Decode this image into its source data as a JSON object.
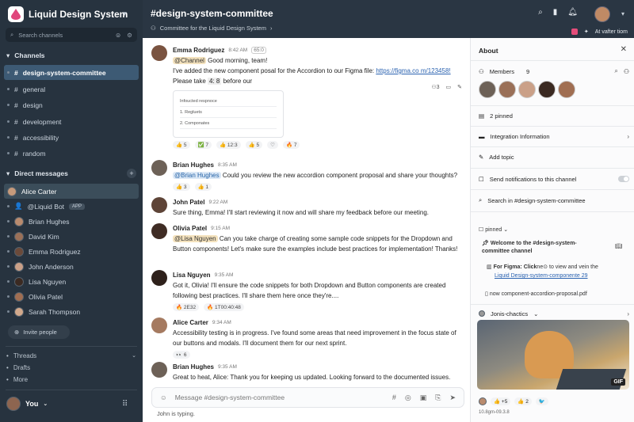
{
  "workspace": {
    "name": "Liquid Design System"
  },
  "sidebar": {
    "search_placeholder": "Search channels",
    "channels_label": "Channels",
    "channels": [
      {
        "name": "design-system-committee",
        "active": true
      },
      {
        "name": "general"
      },
      {
        "name": "design"
      },
      {
        "name": "development"
      },
      {
        "name": "accessibility"
      },
      {
        "name": "random"
      }
    ],
    "dm_label": "Direct messages",
    "dms": [
      {
        "name": "Alice Carter",
        "active": true
      },
      {
        "name": "@Liquid Bot",
        "badge": "APP"
      },
      {
        "name": "Brian Hughes"
      },
      {
        "name": "David Kim"
      },
      {
        "name": "Emma Rodriguez"
      },
      {
        "name": "John Anderson"
      },
      {
        "name": "Lisa Nguyen"
      },
      {
        "name": "Olivia Patel"
      },
      {
        "name": "Sarah Thompson"
      }
    ],
    "invite": "Invite people",
    "threads": "Threads",
    "drafts": "Drafts",
    "more": "More",
    "user": "You"
  },
  "header": {
    "title": "#design-system-committee",
    "subtitle": "Committee for the Liquid Design System",
    "right_text": "At vafter tiom"
  },
  "messages": [
    {
      "author": "Emma Rodriguez",
      "time": "8:42 AM",
      "tag": "65:0",
      "mention": "@Channel",
      "line1": " Good morning, team!",
      "line2a": "I've added the new component posal for the Accordion to our Figma file: ",
      "link": "https://figma.co m/123458!",
      "line2b": " Please take ",
      "hl": "4: 8",
      "line2c": " before our",
      "mini": [
        "Infoucted respnoce",
        "1. Regluets",
        "2. Componates"
      ],
      "reactions": [
        "👍 5",
        "✅ 7",
        "👍 12:3",
        "👍 5",
        "♡",
        "🔥 7",
        "😄 7"
      ]
    },
    {
      "author": "Brian Hughes",
      "time": "8:35 AM",
      "mention": "@Brian Hughes",
      "text": "Could you review the new accordion component proposal and share your thoughts?",
      "reactions": [
        "👍 3",
        "👍 1"
      ]
    },
    {
      "author": "John Patel",
      "time": "9:22 AM",
      "text": "Sure thing, Emma! I'll start reviewing it now and will share my feedback before our meeting."
    },
    {
      "author": "Olivia Patel",
      "time": "9:15 AM",
      "mention": "@Lisa Nguyen",
      "text": "Can you take charge of creating some sample code snippets for the Dropdown and Button components! Let's make sure the examples include best practices for implementation! Thanks!"
    },
    {
      "author": "Lisa Nguyen",
      "time": "9:35 AM",
      "text": "Got it, Olivia! I'll ensure the code snippets for both Dropdown and Button components are created following best practices. I'll share them here once they're....",
      "reactions": [
        "🔥 2E32",
        "🔥 1T00:40:48"
      ]
    },
    {
      "author": "Alice Carter",
      "time": "9:34 AM",
      "text": "Accessibility testing is in progress. I've found some areas that need improvement in the focus state of our buttons and modals. I'll document them for our next sprint.",
      "reactions": [
        "👀 6"
      ]
    },
    {
      "author": "Brian Hughes",
      "time": "9:35 AM",
      "text": "Great to heat, Alice: Thank you for keeping us updated. Looking forward to the documented issues."
    }
  ],
  "header_actions": {
    "count": "3"
  },
  "composer": {
    "placeholder": "Message #design-system-committee",
    "typing": "John is typing."
  },
  "about": {
    "title": "About",
    "members_label": "Members",
    "members_count": "9",
    "pinned": "2 pinned",
    "integration": "Integration Information",
    "add_topic": "Add topic",
    "notifications": "Send notifications to this channel",
    "search": "Search in #design-system-committee",
    "pinned_label": "pinned",
    "welcome": "Welcome to the #design-system-committee channel",
    "figma_a": "For Figma: Click",
    "figma_b": "ne⊙ to view and vein the",
    "figma_link": "Liquid Design-system-componente 29",
    "file": "now component-accordion-proposal.pdf",
    "gif_author": "Jonis-chactics",
    "gif_label": "GIF",
    "gif_reacts": [
      "👍 +5",
      "👍 2",
      "🐦"
    ],
    "gif_meta": "10.8gm-09.3.8"
  }
}
